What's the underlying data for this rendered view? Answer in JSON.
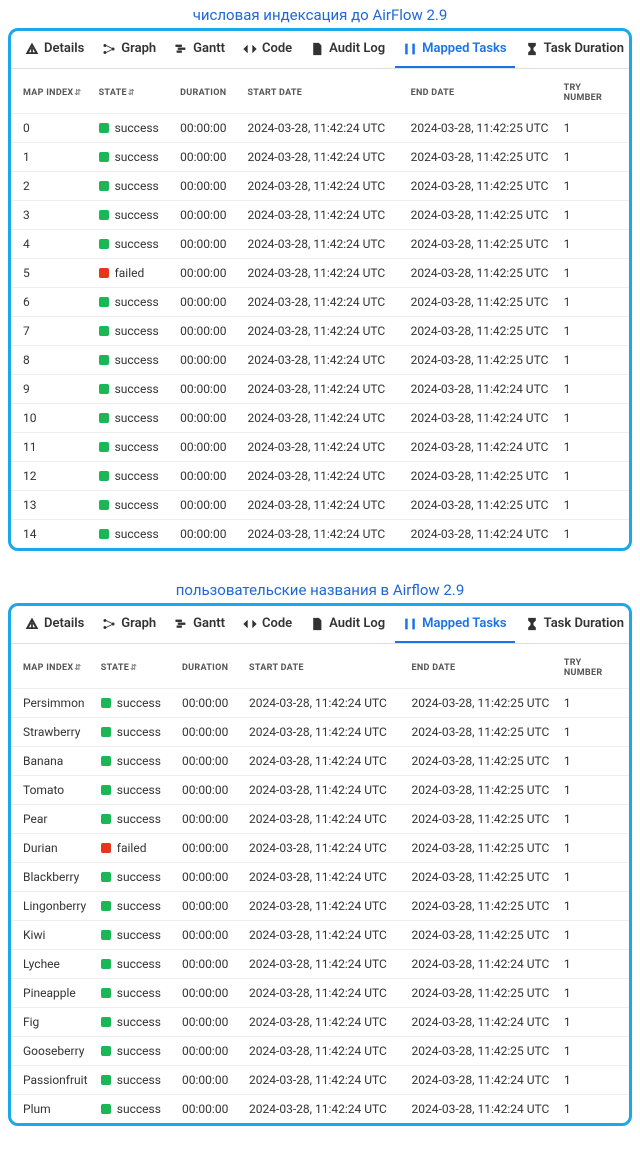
{
  "caption1": "числовая индексация до AirFlow 2.9",
  "caption2": "пользовательские названия в Airflow 2.9",
  "tabs": {
    "details": "Details",
    "graph": "Graph",
    "gantt": "Gantt",
    "code": "Code",
    "audit": "Audit Log",
    "mapped": "Mapped Tasks",
    "duration": "Task Duration"
  },
  "headers": {
    "map_index": "MAP INDEX",
    "state": "STATE",
    "duration": "DURATION",
    "start_date": "START DATE",
    "end_date": "END DATE",
    "try_number": "TRY NUMBER"
  },
  "states": {
    "success": "success",
    "failed": "failed"
  },
  "panel1_rows": [
    {
      "idx": "0",
      "state": "success",
      "dur": "00:00:00",
      "start": "2024-03-28, 11:42:24 UTC",
      "end": "2024-03-28, 11:42:25 UTC",
      "try": "1"
    },
    {
      "idx": "1",
      "state": "success",
      "dur": "00:00:00",
      "start": "2024-03-28, 11:42:24 UTC",
      "end": "2024-03-28, 11:42:25 UTC",
      "try": "1"
    },
    {
      "idx": "2",
      "state": "success",
      "dur": "00:00:00",
      "start": "2024-03-28, 11:42:24 UTC",
      "end": "2024-03-28, 11:42:25 UTC",
      "try": "1"
    },
    {
      "idx": "3",
      "state": "success",
      "dur": "00:00:00",
      "start": "2024-03-28, 11:42:24 UTC",
      "end": "2024-03-28, 11:42:25 UTC",
      "try": "1"
    },
    {
      "idx": "4",
      "state": "success",
      "dur": "00:00:00",
      "start": "2024-03-28, 11:42:24 UTC",
      "end": "2024-03-28, 11:42:25 UTC",
      "try": "1"
    },
    {
      "idx": "5",
      "state": "failed",
      "dur": "00:00:00",
      "start": "2024-03-28, 11:42:24 UTC",
      "end": "2024-03-28, 11:42:25 UTC",
      "try": "1"
    },
    {
      "idx": "6",
      "state": "success",
      "dur": "00:00:00",
      "start": "2024-03-28, 11:42:24 UTC",
      "end": "2024-03-28, 11:42:25 UTC",
      "try": "1"
    },
    {
      "idx": "7",
      "state": "success",
      "dur": "00:00:00",
      "start": "2024-03-28, 11:42:24 UTC",
      "end": "2024-03-28, 11:42:25 UTC",
      "try": "1"
    },
    {
      "idx": "8",
      "state": "success",
      "dur": "00:00:00",
      "start": "2024-03-28, 11:42:24 UTC",
      "end": "2024-03-28, 11:42:25 UTC",
      "try": "1"
    },
    {
      "idx": "9",
      "state": "success",
      "dur": "00:00:00",
      "start": "2024-03-28, 11:42:24 UTC",
      "end": "2024-03-28, 11:42:24 UTC",
      "try": "1"
    },
    {
      "idx": "10",
      "state": "success",
      "dur": "00:00:00",
      "start": "2024-03-28, 11:42:24 UTC",
      "end": "2024-03-28, 11:42:24 UTC",
      "try": "1"
    },
    {
      "idx": "11",
      "state": "success",
      "dur": "00:00:00",
      "start": "2024-03-28, 11:42:24 UTC",
      "end": "2024-03-28, 11:42:24 UTC",
      "try": "1"
    },
    {
      "idx": "12",
      "state": "success",
      "dur": "00:00:00",
      "start": "2024-03-28, 11:42:24 UTC",
      "end": "2024-03-28, 11:42:25 UTC",
      "try": "1"
    },
    {
      "idx": "13",
      "state": "success",
      "dur": "00:00:00",
      "start": "2024-03-28, 11:42:24 UTC",
      "end": "2024-03-28, 11:42:25 UTC",
      "try": "1"
    },
    {
      "idx": "14",
      "state": "success",
      "dur": "00:00:00",
      "start": "2024-03-28, 11:42:24 UTC",
      "end": "2024-03-28, 11:42:24 UTC",
      "try": "1"
    }
  ],
  "panel2_rows": [
    {
      "idx": "Persimmon",
      "state": "success",
      "dur": "00:00:00",
      "start": "2024-03-28, 11:42:24 UTC",
      "end": "2024-03-28, 11:42:25 UTC",
      "try": "1"
    },
    {
      "idx": "Strawberry",
      "state": "success",
      "dur": "00:00:00",
      "start": "2024-03-28, 11:42:24 UTC",
      "end": "2024-03-28, 11:42:25 UTC",
      "try": "1"
    },
    {
      "idx": "Banana",
      "state": "success",
      "dur": "00:00:00",
      "start": "2024-03-28, 11:42:24 UTC",
      "end": "2024-03-28, 11:42:25 UTC",
      "try": "1"
    },
    {
      "idx": "Tomato",
      "state": "success",
      "dur": "00:00:00",
      "start": "2024-03-28, 11:42:24 UTC",
      "end": "2024-03-28, 11:42:25 UTC",
      "try": "1"
    },
    {
      "idx": "Pear",
      "state": "success",
      "dur": "00:00:00",
      "start": "2024-03-28, 11:42:24 UTC",
      "end": "2024-03-28, 11:42:25 UTC",
      "try": "1"
    },
    {
      "idx": "Durian",
      "state": "failed",
      "dur": "00:00:00",
      "start": "2024-03-28, 11:42:24 UTC",
      "end": "2024-03-28, 11:42:25 UTC",
      "try": "1"
    },
    {
      "idx": "Blackberry",
      "state": "success",
      "dur": "00:00:00",
      "start": "2024-03-28, 11:42:24 UTC",
      "end": "2024-03-28, 11:42:25 UTC",
      "try": "1"
    },
    {
      "idx": "Lingonberry",
      "state": "success",
      "dur": "00:00:00",
      "start": "2024-03-28, 11:42:24 UTC",
      "end": "2024-03-28, 11:42:25 UTC",
      "try": "1"
    },
    {
      "idx": "Kiwi",
      "state": "success",
      "dur": "00:00:00",
      "start": "2024-03-28, 11:42:24 UTC",
      "end": "2024-03-28, 11:42:25 UTC",
      "try": "1"
    },
    {
      "idx": "Lychee",
      "state": "success",
      "dur": "00:00:00",
      "start": "2024-03-28, 11:42:24 UTC",
      "end": "2024-03-28, 11:42:24 UTC",
      "try": "1"
    },
    {
      "idx": "Pineapple",
      "state": "success",
      "dur": "00:00:00",
      "start": "2024-03-28, 11:42:24 UTC",
      "end": "2024-03-28, 11:42:25 UTC",
      "try": "1"
    },
    {
      "idx": "Fig",
      "state": "success",
      "dur": "00:00:00",
      "start": "2024-03-28, 11:42:24 UTC",
      "end": "2024-03-28, 11:42:24 UTC",
      "try": "1"
    },
    {
      "idx": "Gooseberry",
      "state": "success",
      "dur": "00:00:00",
      "start": "2024-03-28, 11:42:24 UTC",
      "end": "2024-03-28, 11:42:25 UTC",
      "try": "1"
    },
    {
      "idx": "Passionfruit",
      "state": "success",
      "dur": "00:00:00",
      "start": "2024-03-28, 11:42:24 UTC",
      "end": "2024-03-28, 11:42:24 UTC",
      "try": "1"
    },
    {
      "idx": "Plum",
      "state": "success",
      "dur": "00:00:00",
      "start": "2024-03-28, 11:42:24 UTC",
      "end": "2024-03-28, 11:42:24 UTC",
      "try": "1"
    }
  ]
}
